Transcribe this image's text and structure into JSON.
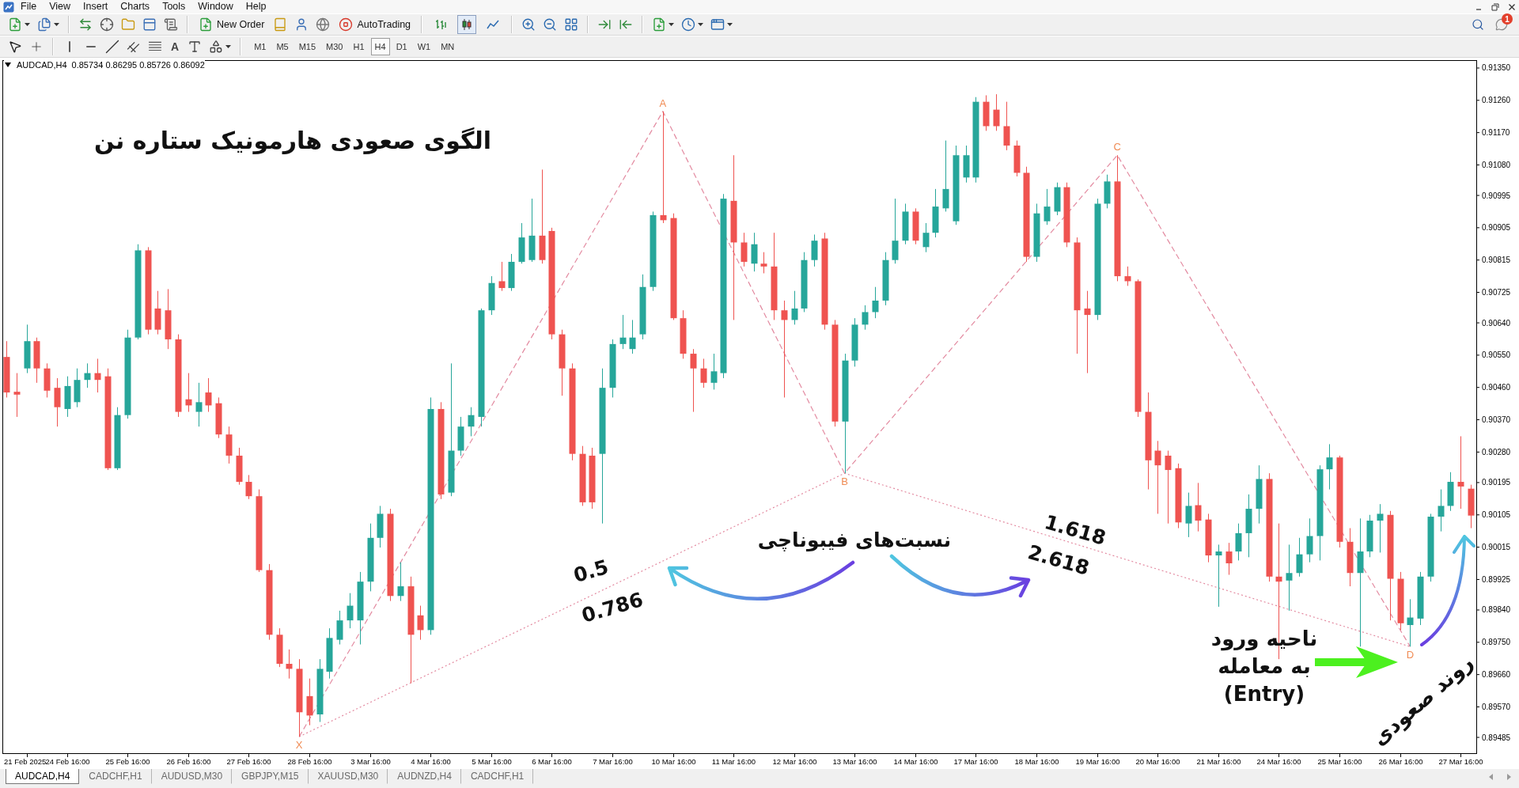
{
  "menu": [
    "File",
    "View",
    "Insert",
    "Charts",
    "Tools",
    "Window",
    "Help"
  ],
  "toolbar": {
    "new_order": "New Order",
    "auto_trading": "AutoTrading",
    "chart_type": [
      {
        "kind": "bars",
        "selected": false
      },
      {
        "kind": "candles",
        "selected": true
      },
      {
        "kind": "line",
        "selected": false
      }
    ],
    "notifications": "1"
  },
  "drawing_tools": {
    "text_tool": "A"
  },
  "timeframes": [
    {
      "label": "M1",
      "selected": false
    },
    {
      "label": "M5",
      "selected": false
    },
    {
      "label": "M15",
      "selected": false
    },
    {
      "label": "M30",
      "selected": false
    },
    {
      "label": "H1",
      "selected": false
    },
    {
      "label": "H4",
      "selected": true
    },
    {
      "label": "D1",
      "selected": false
    },
    {
      "label": "W1",
      "selected": false
    },
    {
      "label": "MN",
      "selected": false
    }
  ],
  "chart": {
    "symbol": "AUDCAD,H4",
    "reading": "0.85734 0.86295 0.85726 0.86092",
    "heading": "الگوی صعودی هارمونیک ستاره نن",
    "fib_label": "نسبت‌های فیبوناچی",
    "left_ratios": [
      "0.5",
      "0.786"
    ],
    "right_ratios": [
      "1.618",
      "2.618"
    ],
    "entry_label": [
      "ناحیه ورود",
      "به معامله",
      "(Entry)"
    ],
    "trend_label": "روند صعودی",
    "chart_data": [
      {
        "type": "candlestick",
        "categories": [
          null,
          null,
          "21 Feb 2025",
          null,
          null,
          null,
          "24 Feb 16:00",
          null,
          null,
          null,
          null,
          null,
          "25 Feb 16:00",
          null,
          null,
          null,
          null,
          null,
          "26 Feb 16:00",
          null,
          null,
          null,
          null,
          null,
          "27 Feb 16:00",
          null,
          null,
          null,
          null,
          null,
          "28 Feb 16:00",
          null,
          null,
          null,
          null,
          null,
          "3 Mar 16:00",
          null,
          null,
          null,
          null,
          null,
          "4 Mar 16:00",
          null,
          null,
          null,
          null,
          null,
          "5 Mar 16:00",
          null,
          null,
          null,
          null,
          null,
          "6 Mar 16:00",
          null,
          null,
          null,
          null,
          null,
          "7 Mar 16:00",
          null,
          null,
          null,
          null,
          null,
          "10 Mar 16:00",
          null,
          null,
          null,
          null,
          null,
          "11 Mar 16:00",
          null,
          null,
          null,
          null,
          null,
          "12 Mar 16:00",
          null,
          null,
          null,
          null,
          null,
          "13 Mar 16:00",
          null,
          null,
          null,
          null,
          null,
          "14 Mar 16:00",
          null,
          null,
          null,
          null,
          null,
          "17 Mar 16:00",
          null,
          null,
          null,
          null,
          null,
          "18 Mar 16:00",
          null,
          null,
          null,
          null,
          null,
          "19 Mar 16:00",
          null,
          null,
          null,
          null,
          null,
          "20 Mar 16:00",
          null,
          null,
          null,
          null,
          null,
          "21 Mar 16:00",
          null,
          null,
          null,
          null,
          null,
          "24 Mar 16:00",
          null,
          null,
          null,
          null,
          null,
          "25 Mar 16:00",
          null,
          null,
          null,
          null,
          null,
          "26 Mar 16:00",
          null,
          null,
          null,
          null,
          null,
          "27 Mar 16:00",
          null
        ],
        "ohlc": [
          [
            0.90545,
            0.90589,
            0.90432,
            0.90446
          ],
          [
            0.90448,
            0.905,
            0.90378,
            0.9044
          ],
          [
            0.90513,
            0.90635,
            0.905,
            0.90589
          ],
          [
            0.90589,
            0.90599,
            0.90473,
            0.90513
          ],
          [
            0.90513,
            0.90527,
            0.90432,
            0.90451
          ],
          [
            0.90459,
            0.90486,
            0.90351,
            0.90405
          ],
          [
            0.904,
            0.90491,
            0.90378,
            0.90464
          ],
          [
            0.90419,
            0.90513,
            0.90405,
            0.90481
          ],
          [
            0.90481,
            0.90527,
            0.90459,
            0.905
          ],
          [
            0.905,
            0.9054,
            0.90446,
            0.90481
          ],
          [
            0.90491,
            0.90513,
            0.9023,
            0.90235
          ],
          [
            0.90235,
            0.90405,
            0.9023,
            0.90383
          ],
          [
            0.90383,
            0.90621,
            0.90373,
            0.90599
          ],
          [
            0.90599,
            0.90859,
            0.90594,
            0.90842
          ],
          [
            0.90842,
            0.90851,
            0.90608,
            0.90621
          ],
          [
            0.9068,
            0.90729,
            0.90608,
            0.90621
          ],
          [
            0.90675,
            0.90734,
            0.90567,
            0.90594
          ],
          [
            0.90594,
            0.90608,
            0.90378,
            0.90392
          ],
          [
            0.90427,
            0.905,
            0.90392,
            0.9041
          ],
          [
            0.90392,
            0.90473,
            0.90351,
            0.90419
          ],
          [
            0.90446,
            0.90486,
            0.90392,
            0.9041
          ],
          [
            0.90416,
            0.90432,
            0.90319,
            0.90329
          ],
          [
            0.90329,
            0.90351,
            0.90248,
            0.9027
          ],
          [
            0.9027,
            0.90292,
            0.90189,
            0.90197
          ],
          [
            0.90197,
            0.90216,
            0.90149,
            0.90157
          ],
          [
            0.90157,
            0.90176,
            0.89946,
            0.89951
          ],
          [
            0.89951,
            0.89968,
            0.89757,
            0.89771
          ],
          [
            0.89771,
            0.89789,
            0.89681,
            0.8969
          ],
          [
            0.8969,
            0.8973,
            0.89649,
            0.89676
          ],
          [
            0.89676,
            0.89703,
            0.89487,
            0.89555
          ],
          [
            0.896,
            0.89649,
            0.89519,
            0.89546
          ],
          [
            0.89549,
            0.89703,
            0.89528,
            0.89676
          ],
          [
            0.89668,
            0.89789,
            0.89649,
            0.89762
          ],
          [
            0.89757,
            0.89838,
            0.89744,
            0.89811
          ],
          [
            0.89811,
            0.89887,
            0.89789,
            0.89852
          ],
          [
            0.89811,
            0.89946,
            0.89744,
            0.89919
          ],
          [
            0.89919,
            0.90081,
            0.89892,
            0.90041
          ],
          [
            0.90041,
            0.9013,
            0.90014,
            0.90108
          ],
          [
            0.90108,
            0.90122,
            0.89865,
            0.89879
          ],
          [
            0.89879,
            0.89973,
            0.89865,
            0.89906
          ],
          [
            0.89906,
            0.89933,
            0.89636,
            0.89771
          ],
          [
            0.89825,
            0.89852,
            0.89757,
            0.89784
          ],
          [
            0.89784,
            0.90432,
            0.89771,
            0.904
          ],
          [
            0.904,
            0.90419,
            0.90149,
            0.90162
          ],
          [
            0.90167,
            0.90527,
            0.90157,
            0.90284
          ],
          [
            0.90284,
            0.90378,
            0.9027,
            0.90351
          ],
          [
            0.90351,
            0.90405,
            0.90324,
            0.90383
          ],
          [
            0.90378,
            0.9068,
            0.90351,
            0.90675
          ],
          [
            0.90675,
            0.9077,
            0.90662,
            0.90751
          ],
          [
            0.90756,
            0.9081,
            0.90729,
            0.90737
          ],
          [
            0.90737,
            0.90832,
            0.90729,
            0.9081
          ],
          [
            0.9081,
            0.90918,
            0.90805,
            0.90878
          ],
          [
            0.90815,
            0.90986,
            0.9081,
            0.90883
          ],
          [
            0.90883,
            0.91067,
            0.90805,
            0.90815
          ],
          [
            0.90896,
            0.90905,
            0.90594,
            0.90608
          ],
          [
            0.90608,
            0.90621,
            0.90437,
            0.90513
          ],
          [
            0.90513,
            0.90527,
            0.90257,
            0.90275
          ],
          [
            0.90275,
            0.90297,
            0.9013,
            0.9014
          ],
          [
            0.9027,
            0.90292,
            0.90122,
            0.9014
          ],
          [
            0.90275,
            0.90513,
            0.90081,
            0.90459
          ],
          [
            0.90459,
            0.90594,
            0.90432,
            0.90581
          ],
          [
            0.90581,
            0.90662,
            0.90567,
            0.90599
          ],
          [
            0.90567,
            0.90648,
            0.90554,
            0.90599
          ],
          [
            0.90608,
            0.90775,
            0.90594,
            0.9074
          ],
          [
            0.9074,
            0.9095,
            0.90729,
            0.9094
          ],
          [
            0.9094,
            0.91229,
            0.90918,
            0.90926
          ],
          [
            0.90932,
            0.90945,
            0.90648,
            0.90653
          ],
          [
            0.90653,
            0.90675,
            0.9054,
            0.90554
          ],
          [
            0.90554,
            0.90567,
            0.90392,
            0.90513
          ],
          [
            0.90513,
            0.9054,
            0.90459,
            0.90473
          ],
          [
            0.90473,
            0.90554,
            0.90454,
            0.90505
          ],
          [
            0.905,
            0.90999,
            0.90486,
            0.90986
          ],
          [
            0.9098,
            0.91107,
            0.90648,
            0.90864
          ],
          [
            0.90864,
            0.90891,
            0.90797,
            0.9081
          ],
          [
            0.90805,
            0.90891,
            0.90783,
            0.90859
          ],
          [
            0.90805,
            0.90837,
            0.90778,
            0.90797
          ],
          [
            0.90797,
            0.90891,
            0.90648,
            0.90675
          ],
          [
            0.90675,
            0.90702,
            0.90432,
            0.90648
          ],
          [
            0.90648,
            0.90729,
            0.90635,
            0.9068
          ],
          [
            0.9068,
            0.90837,
            0.9067,
            0.90815
          ],
          [
            0.90815,
            0.90886,
            0.90797,
            0.90869
          ],
          [
            0.90875,
            0.90891,
            0.90621,
            0.90635
          ],
          [
            0.90635,
            0.90648,
            0.90351,
            0.90365
          ],
          [
            0.90365,
            0.90554,
            0.90221,
            0.90535
          ],
          [
            0.90535,
            0.90653,
            0.90518,
            0.90635
          ],
          [
            0.90635,
            0.90689,
            0.90621,
            0.9067
          ],
          [
            0.9067,
            0.9074,
            0.90653,
            0.90702
          ],
          [
            0.90702,
            0.90837,
            0.90689,
            0.90815
          ],
          [
            0.90815,
            0.90986,
            0.90805,
            0.90869
          ],
          [
            0.90869,
            0.90972,
            0.90859,
            0.9095
          ],
          [
            0.9095,
            0.90959,
            0.90859,
            0.90869
          ],
          [
            0.90851,
            0.90918,
            0.90837,
            0.90891
          ],
          [
            0.90891,
            0.91013,
            0.90878,
            0.90964
          ],
          [
            0.90959,
            0.91148,
            0.9095,
            0.91013
          ],
          [
            0.90923,
            0.91134,
            0.90913,
            0.91107
          ],
          [
            0.91045,
            0.91134,
            0.91031,
            0.91107
          ],
          [
            0.91045,
            0.91269,
            0.91031,
            0.91256
          ],
          [
            0.91256,
            0.91274,
            0.91175,
            0.91188
          ],
          [
            0.91234,
            0.91277,
            0.91175,
            0.91188
          ],
          [
            0.91188,
            0.91256,
            0.91121,
            0.91134
          ],
          [
            0.91134,
            0.91148,
            0.91048,
            0.91058
          ],
          [
            0.91058,
            0.91075,
            0.9081,
            0.90824
          ],
          [
            0.90824,
            0.90972,
            0.9081,
            0.90945
          ],
          [
            0.90923,
            0.91013,
            0.90913,
            0.90964
          ],
          [
            0.9095,
            0.91031,
            0.9094,
            0.91018
          ],
          [
            0.91018,
            0.91031,
            0.90851,
            0.90864
          ],
          [
            0.90864,
            0.90878,
            0.90554,
            0.90675
          ],
          [
            0.9068,
            0.90729,
            0.905,
            0.90662
          ],
          [
            0.90662,
            0.90986,
            0.90648,
            0.90972
          ],
          [
            0.90972,
            0.91053,
            0.90959,
            0.91034
          ],
          [
            0.91034,
            0.91107,
            0.90756,
            0.9077
          ],
          [
            0.9077,
            0.90797,
            0.90743,
            0.90756
          ],
          [
            0.90756,
            0.90761,
            0.90378,
            0.90392
          ],
          [
            0.90392,
            0.90446,
            0.90176,
            0.90257
          ],
          [
            0.90284,
            0.90311,
            0.90108,
            0.90243
          ],
          [
            0.9027,
            0.90284,
            0.90081,
            0.9023
          ],
          [
            0.90235,
            0.90248,
            0.90068,
            0.90084
          ],
          [
            0.90081,
            0.90167,
            0.90043,
            0.9013
          ],
          [
            0.90132,
            0.90194,
            0.90059,
            0.90089
          ],
          [
            0.90092,
            0.90108,
            0.89973,
            0.89992
          ],
          [
            0.89992,
            0.90022,
            0.89849,
            0.90003
          ],
          [
            0.90003,
            0.90027,
            0.89938,
            0.8997
          ],
          [
            0.90003,
            0.90081,
            0.89978,
            0.90054
          ],
          [
            0.90054,
            0.90162,
            0.89987,
            0.90122
          ],
          [
            0.90122,
            0.90243,
            0.90081,
            0.90205
          ],
          [
            0.90205,
            0.90221,
            0.89919,
            0.89933
          ],
          [
            0.89933,
            0.90081,
            0.89703,
            0.89919
          ],
          [
            0.89922,
            0.90022,
            0.89838,
            0.89943
          ],
          [
            0.89943,
            0.90041,
            0.89933,
            0.89995
          ],
          [
            0.89995,
            0.90095,
            0.89973,
            0.90046
          ],
          [
            0.90046,
            0.90243,
            0.89978,
            0.90232
          ],
          [
            0.90232,
            0.90302,
            0.90176,
            0.90265
          ],
          [
            0.90265,
            0.9027,
            0.90014,
            0.9003
          ],
          [
            0.9003,
            0.90068,
            0.89906,
            0.89943
          ],
          [
            0.89943,
            0.90095,
            0.89738,
            0.90003
          ],
          [
            0.90003,
            0.90105,
            0.89987,
            0.90089
          ],
          [
            0.90089,
            0.90135,
            0.9,
            0.90108
          ],
          [
            0.90105,
            0.90116,
            0.89811,
            0.89927
          ],
          [
            0.89927,
            0.89946,
            0.89784,
            0.89803
          ],
          [
            0.89798,
            0.8987,
            0.89738,
            0.89819
          ],
          [
            0.89816,
            0.89946,
            0.89798,
            0.89933
          ],
          [
            0.89933,
            0.90108,
            0.89919,
            0.901
          ],
          [
            0.901,
            0.90176,
            0.90059,
            0.9013
          ],
          [
            0.9013,
            0.90224,
            0.90116,
            0.90197
          ],
          [
            0.90197,
            0.90324,
            0.90122,
            0.90184
          ],
          [
            0.90178,
            0.90189,
            0.90068,
            0.90103
          ]
        ],
        "ylim": [
          0.89441,
          0.91372
        ],
        "yticks": [
          {
            "value": 0.9135,
            "label": "0.91350"
          },
          {
            "value": 0.9126,
            "label": "0.91260"
          },
          {
            "value": 0.9117,
            "label": "0.91170"
          },
          {
            "value": 0.9108,
            "label": "0.91080"
          },
          {
            "value": 0.90995,
            "label": "0.90995"
          },
          {
            "value": 0.90905,
            "label": "0.90905"
          },
          {
            "value": 0.90815,
            "label": "0.90815"
          },
          {
            "value": 0.90725,
            "label": "0.90725"
          },
          {
            "value": 0.9064,
            "label": "0.90640"
          },
          {
            "value": 0.9055,
            "label": "0.90550"
          },
          {
            "value": 0.9046,
            "label": "0.90460"
          },
          {
            "value": 0.9037,
            "label": "0.90370"
          },
          {
            "value": 0.9028,
            "label": "0.90280"
          },
          {
            "value": 0.90195,
            "label": "0.90195"
          },
          {
            "value": 0.90105,
            "label": "0.90105"
          },
          {
            "value": 0.90015,
            "label": "0.90015"
          },
          {
            "value": 0.89925,
            "label": "0.89925"
          },
          {
            "value": 0.8984,
            "label": "0.89840"
          },
          {
            "value": 0.8975,
            "label": "0.89750"
          },
          {
            "value": 0.8966,
            "label": "0.89660"
          },
          {
            "value": 0.8957,
            "label": "0.89570"
          },
          {
            "value": 0.89485,
            "label": "0.89485"
          }
        ],
        "series": [
          {
            "type": "line",
            "color": "#e38aa0",
            "line_style": "dashed",
            "values": [
              null,
              null,
              null,
              null,
              null,
              null,
              null,
              null,
              null,
              null,
              null,
              null,
              null,
              null,
              null,
              null,
              null,
              null,
              null,
              null,
              null,
              null,
              null,
              null,
              null,
              null,
              null,
              null,
              null,
              0.89487,
              null,
              null,
              null,
              null,
              null,
              null,
              null,
              null,
              null,
              null,
              null,
              null,
              null,
              null,
              null,
              null,
              null,
              null,
              null,
              null,
              null,
              null,
              null,
              null,
              null,
              null,
              null,
              null,
              null,
              null,
              null,
              null,
              null,
              null,
              null,
              0.91229,
              null,
              null,
              null,
              null,
              null,
              null,
              null,
              null,
              null,
              null,
              null,
              null,
              null,
              null,
              null,
              null,
              null,
              0.90221,
              null,
              null,
              null,
              null,
              null,
              null,
              null,
              null,
              null,
              null,
              null,
              null,
              null,
              null,
              null,
              null,
              null,
              null,
              null,
              null,
              null,
              null,
              null,
              null,
              null,
              null,
              0.91107,
              null,
              null,
              null,
              null,
              null,
              null,
              null,
              null,
              null,
              null,
              null,
              null,
              null,
              null,
              null,
              null,
              null,
              null,
              null,
              null,
              null,
              null,
              null,
              null,
              null,
              null,
              null,
              null,
              0.89738,
              null,
              null,
              null,
              null,
              null,
              null
            ]
          },
          {
            "type": "line",
            "color": "#e38aa0",
            "line_style": "dotted",
            "values": [
              null,
              null,
              null,
              null,
              null,
              null,
              null,
              null,
              null,
              null,
              null,
              null,
              null,
              null,
              null,
              null,
              null,
              null,
              null,
              null,
              null,
              null,
              null,
              null,
              null,
              null,
              null,
              null,
              null,
              0.89487,
              null,
              null,
              null,
              null,
              null,
              null,
              null,
              null,
              null,
              null,
              null,
              null,
              null,
              null,
              null,
              null,
              null,
              null,
              null,
              null,
              null,
              null,
              null,
              null,
              null,
              null,
              null,
              null,
              null,
              null,
              null,
              null,
              null,
              null,
              null,
              null,
              null,
              null,
              null,
              null,
              null,
              null,
              null,
              null,
              null,
              null,
              null,
              null,
              null,
              null,
              null,
              null,
              null,
              0.90221,
              null,
              null,
              null,
              null,
              null,
              null,
              null,
              null,
              null,
              null,
              null,
              null,
              null,
              null,
              null,
              null,
              null,
              null,
              null,
              null,
              null,
              null,
              null,
              null,
              null,
              null,
              null,
              null,
              null,
              null,
              null,
              null,
              null,
              null,
              null,
              null,
              null,
              null,
              null,
              null,
              null,
              null,
              null,
              null,
              null,
              null,
              null,
              null,
              null,
              null,
              null,
              null,
              null,
              null,
              null,
              0.89738,
              null,
              null,
              null,
              null,
              null,
              null
            ]
          }
        ],
        "annotations": [
          "X",
          "A",
          "B",
          "C",
          "D"
        ]
      }
    ]
  },
  "tabs": [
    {
      "label": "AUDCAD,H4",
      "selected": true
    },
    {
      "label": "CADCHF,H1",
      "selected": false
    },
    {
      "label": "AUDUSD,M30",
      "selected": false
    },
    {
      "label": "GBPJPY,M15",
      "selected": false
    },
    {
      "label": "XAUUSD,M30",
      "selected": false
    },
    {
      "label": "AUDNZD,H4",
      "selected": false
    },
    {
      "label": "CADCHF,H1",
      "selected": false
    }
  ]
}
